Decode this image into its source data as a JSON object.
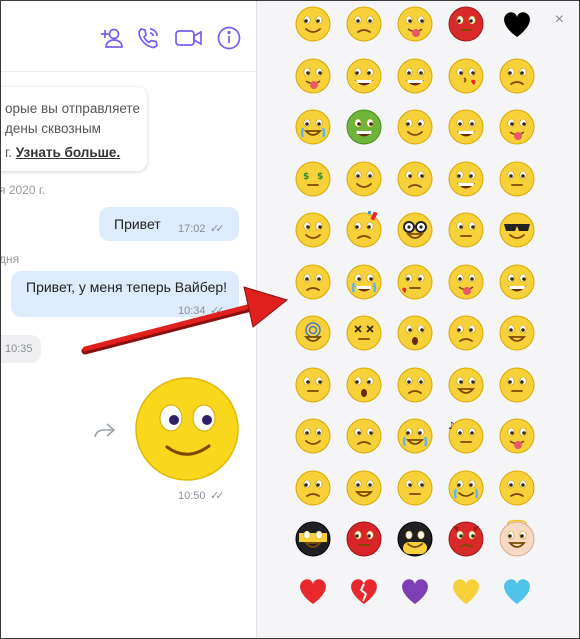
{
  "header": {
    "icons": [
      {
        "name": "add-user-icon"
      },
      {
        "name": "phone-call-icon"
      },
      {
        "name": "video-call-icon"
      },
      {
        "name": "info-icon"
      }
    ]
  },
  "notice": {
    "line1": "орые вы отправляете",
    "line2": "дены сквозным",
    "line3_prefix": "г.",
    "link": "Узнать больше."
  },
  "date_separators": [
    "я 2020 г.",
    "дня"
  ],
  "messages": [
    {
      "text": "Привет",
      "time": "17:02",
      "status": "read"
    },
    {
      "text": "Привет, у меня теперь Вайбер!",
      "time": "10:34",
      "status": "read"
    },
    {
      "text": "",
      "time": "10:35",
      "status": "incoming"
    },
    {
      "text": "",
      "time": "10:50",
      "status": "read",
      "type": "sticker"
    }
  ],
  "emoji_panel": {
    "close_label": "×",
    "rows": [
      [
        "happy-smile",
        "sad-face",
        "winking-tongue",
        "angry-red",
        "heart-eyes"
      ],
      [
        "tongue-out",
        "laughing",
        "shocked",
        "kissing-heart",
        "smiling"
      ],
      [
        "crying-blue",
        "sick-green",
        "worried",
        "grinning",
        "tongue-tease"
      ],
      [
        "money-eyes",
        "smirk",
        "wink",
        "big-grin",
        "neutral-frown"
      ],
      [
        "sad",
        "party-confetti",
        "nerd-glasses",
        "unamused",
        "sunglasses"
      ],
      [
        "silly",
        "crying-laughing",
        "blushing-heart",
        "tongue-down",
        "squint-grin"
      ],
      [
        "dizzy",
        "x-eyes",
        "confused",
        "rolling-eyes",
        "angry"
      ],
      [
        "nervous",
        "surprised-o",
        "smirk-side",
        "upside-look",
        "pleading"
      ],
      [
        "frowning-angry",
        "tired",
        "teary",
        "music-whistle",
        "laughing-tongue"
      ],
      [
        "skeptical",
        "grumpy",
        "thinking",
        "crying-streams",
        "eyes-up"
      ],
      [
        "ninja",
        "spider",
        "bat-mask",
        "devil",
        "angel-baby"
      ],
      [
        "heart-red",
        "heart-broken",
        "heart-purple",
        "heart-yellow",
        "heart-blue"
      ]
    ]
  },
  "colors": {
    "accent": "#7360f2",
    "bubble_out": "#ddebfd",
    "emoji_yellow": "#f7d13a",
    "arrow_red": "#e0201d"
  }
}
